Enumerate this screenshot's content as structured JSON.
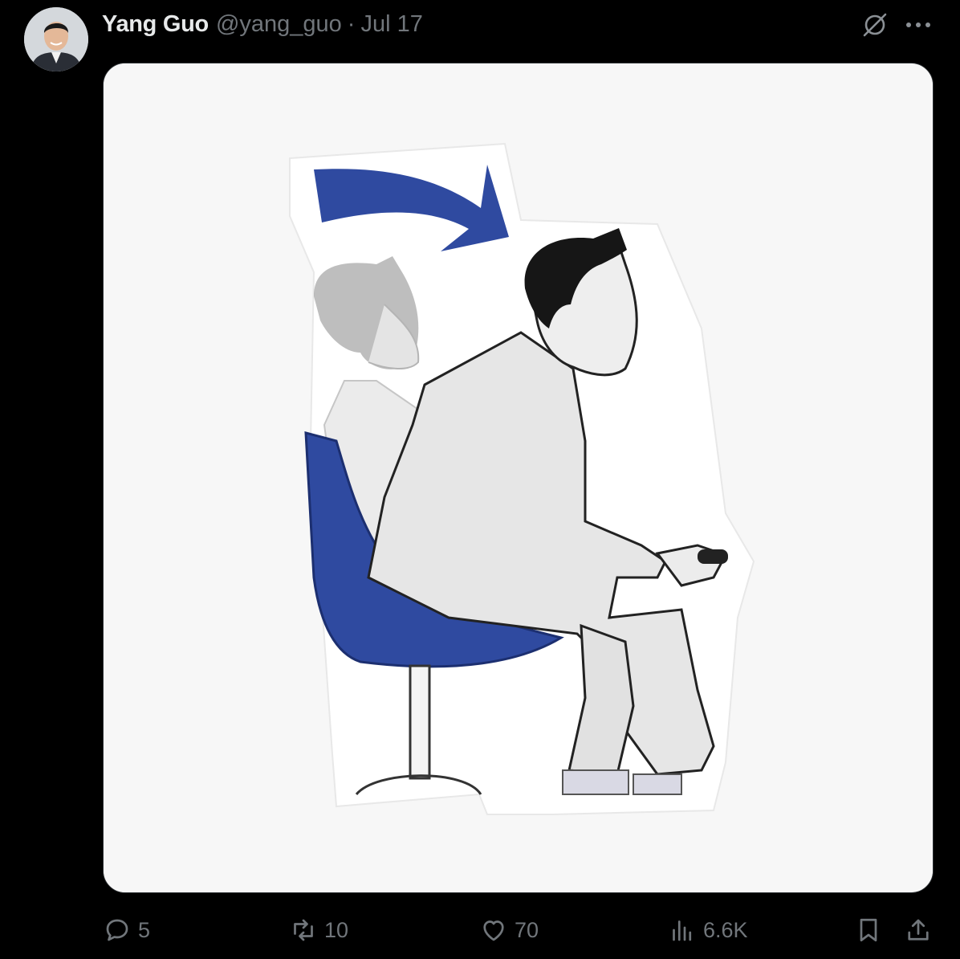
{
  "tweet": {
    "author": {
      "display_name": "Yang Guo",
      "handle": "@yang_guo",
      "separator": "·",
      "timestamp": "Jul 17"
    },
    "media": {
      "description_icon": "illustration-image"
    },
    "actions": {
      "replies": "5",
      "reposts": "10",
      "likes": "70",
      "views": "6.6K"
    }
  },
  "icons": {
    "grok": "grok-icon",
    "more": "more-icon",
    "reply": "reply-icon",
    "repost": "repost-icon",
    "like": "heart-icon",
    "views": "views-icon",
    "bookmark": "bookmark-icon",
    "share": "share-icon"
  },
  "colors": {
    "background": "#000000",
    "text_primary": "#e7e9ea",
    "text_secondary": "#71767b",
    "chair_blue": "#2f4aa0"
  }
}
